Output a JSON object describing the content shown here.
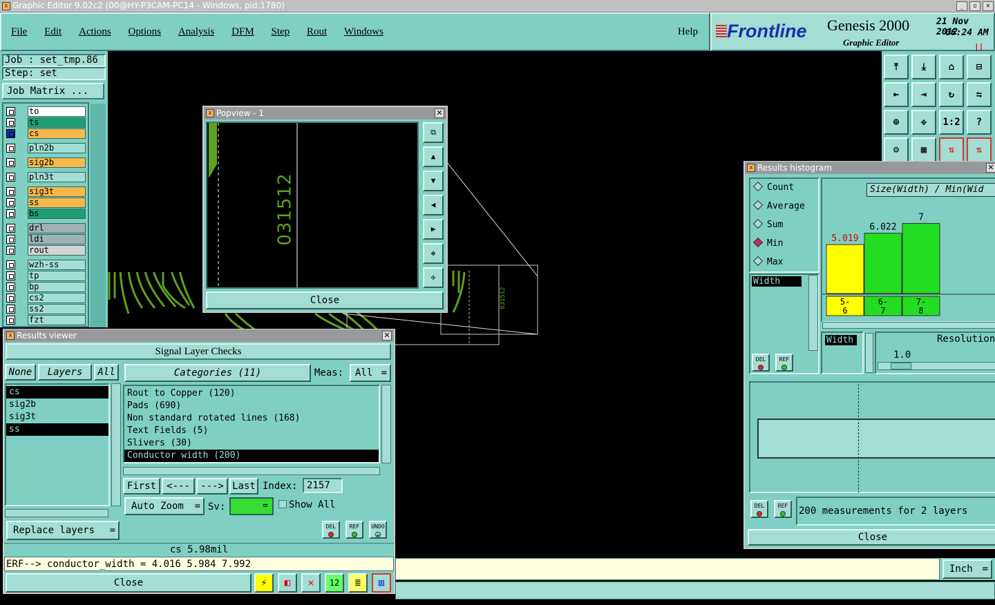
{
  "window_title": "Graphic Editor 9.02c2 (00@HY-P3CAM-PC14 - Windows, pid:1780)",
  "menu": [
    "File",
    "Edit",
    "Actions",
    "Options",
    "Analysis",
    "DFM",
    "Step",
    "Rout",
    "Windows"
  ],
  "help": "Help",
  "brand": {
    "logo": "Frontline",
    "product": "Genesis 2000",
    "subtitle": "Graphic Editor",
    "date": "21 Nov 2012",
    "time": "06:24 AM"
  },
  "job": {
    "job_label": "Job : set_tmp.86",
    "step_label": "Step: set",
    "matrix_button": "Job Matrix ..."
  },
  "layers": [
    {
      "name": "to",
      "color": "#ffffff"
    },
    {
      "name": "ts",
      "color": "#1f9e72"
    },
    {
      "name": "cs",
      "color": "#f7b84a"
    },
    {
      "name": "pln2b",
      "color": "#a3ddd3"
    },
    {
      "name": "sig2b",
      "color": "#f7b84a"
    },
    {
      "name": "pln3t",
      "color": "#a3ddd3"
    },
    {
      "name": "sig3t",
      "color": "#f7b84a"
    },
    {
      "name": "ss",
      "color": "#f7b84a"
    },
    {
      "name": "bs",
      "color": "#1f9e72"
    },
    {
      "name": "drl",
      "color": "#9fb2b4"
    },
    {
      "name": "ldi",
      "color": "#9fb2b4"
    },
    {
      "name": "rout",
      "color": "#d4d4d4"
    },
    {
      "name": "wzh-ss",
      "color": "#a3ddd3"
    },
    {
      "name": "tp",
      "color": "#a3ddd3"
    },
    {
      "name": "bp",
      "color": "#a3ddd3"
    },
    {
      "name": "cs2",
      "color": "#a3ddd3"
    },
    {
      "name": "ss2",
      "color": "#a3ddd3"
    },
    {
      "name": "fzt",
      "color": "#a3ddd3"
    }
  ],
  "popview": {
    "title": "Popview - 1",
    "feature_text": "031512",
    "close": "Close"
  },
  "results_viewer": {
    "title": "Results viewer",
    "header": "Signal Layer Checks",
    "none": "None",
    "layers": "Layers",
    "all": "All",
    "categories_label": "Categories (11)",
    "meas_label": "Meas:",
    "meas_value": "All",
    "layer_list": [
      "cs",
      "sig2b",
      "sig3t",
      "ss"
    ],
    "categories": [
      "Rout to Copper (120)",
      "Pads (690)",
      "Non standard rotated lines (168)",
      "Text Fields (5)",
      "Slivers (30)",
      "Conductor width (200)"
    ],
    "nav": [
      "First",
      "<---",
      "--->",
      "Last"
    ],
    "index_label": "Index:",
    "index_value": "2157",
    "auto_zoom": "Auto Zoom",
    "sv_label": "Sv:",
    "show_all": "Show All",
    "replace_layers": "Replace layers",
    "del": "DEL",
    "ref": "REF",
    "undo": "UNDO",
    "status": "cs 5.98mil",
    "erf": "ERF--> conductor_width = 4.016 5.984 7.992",
    "close": "Close"
  },
  "histogram": {
    "title": "Results histogram",
    "options": [
      "Count",
      "Average",
      "Sum",
      "Min",
      "Max"
    ],
    "selected": "Min",
    "chart_title": "Size(Width) / Min(Wid",
    "width_label": "Width",
    "resolution_label": "Resolution",
    "resolution_value": "1.0",
    "summary": "200 measurements for 2 layers",
    "close": "Close",
    "del": "DEL",
    "ref": "REF"
  },
  "chart_data": {
    "type": "bar",
    "categories": [
      "5-6",
      "6-7",
      "7-8"
    ],
    "values": [
      5.019,
      6.022,
      7
    ],
    "colors": [
      "#ffff00",
      "#22dd22",
      "#22dd22"
    ],
    "title": "Size(Width) / Min(Wid"
  },
  "units": "Inch",
  "toolbar_icons": [
    "zoom-in-icon",
    "zoom-out-icon",
    "home-icon",
    "fit-icon",
    "pan-left-icon",
    "pan-right-icon",
    "rotate-icon",
    "flip-icon",
    "center-icon",
    "move-icon",
    "one-to-two-icon",
    "help-icon"
  ]
}
